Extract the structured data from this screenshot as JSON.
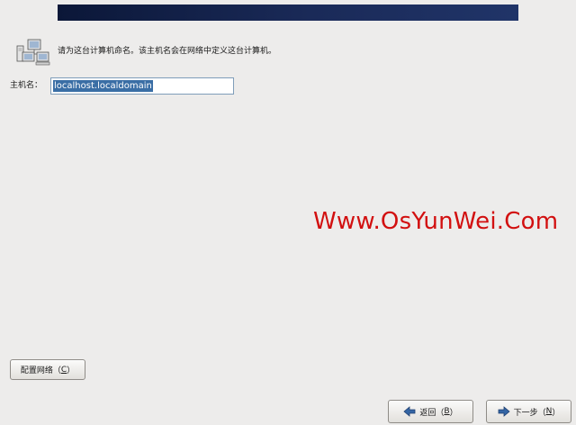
{
  "intro": {
    "text": "请为这台计算机命名。该主机名会在网络中定义这台计算机。"
  },
  "hostname": {
    "label": "主机名：",
    "value": "localhost.localdomain"
  },
  "watermark": {
    "text": "Www.OsYunWei.Com"
  },
  "buttons": {
    "configure_network": {
      "label": "配置网络（",
      "mnemonic": "C",
      "suffix": "）"
    },
    "back": {
      "label": "返回（",
      "mnemonic": "B",
      "suffix": "）",
      "icon": "arrow-left-icon"
    },
    "next": {
      "label": "下一步（",
      "mnemonic": "N",
      "suffix": "）",
      "icon": "arrow-right-icon"
    }
  },
  "colors": {
    "banner": "#1a2a58",
    "watermark": "#d21010",
    "selection": "#3a6ea5",
    "arrow": "#3465a4"
  },
  "icons": {
    "header": "network-computers-icon"
  }
}
